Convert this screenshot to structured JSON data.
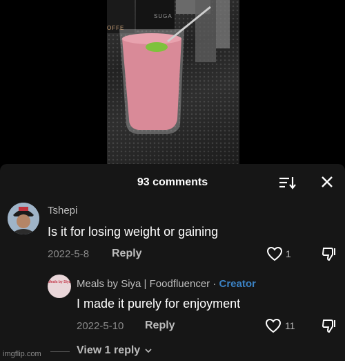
{
  "video": {
    "jar_left_label": "OFFE",
    "jar_right_label": "SUGA"
  },
  "header": {
    "title": "93 comments",
    "sort_icon": "sort-icon",
    "close_icon": "close-icon"
  },
  "comments": [
    {
      "username": "Tshepi",
      "text": "Is it for losing weight or gaining",
      "date": "2022-5-8",
      "reply_label": "Reply",
      "likes": "1"
    }
  ],
  "reply": {
    "username": "Meals by Siya | Foodfluencer",
    "separator": "·",
    "badge": "Creator",
    "avatar_text": "Meals by Siya",
    "text": "I made it purely for enjoyment",
    "date": "2022-5-10",
    "reply_label": "Reply",
    "likes": "11"
  },
  "view_more": "View 1 reply",
  "watermark": "imgflip.com",
  "colors": {
    "panel": "#161616",
    "creator": "#3b82c4",
    "smoothie": "#d98a98"
  }
}
